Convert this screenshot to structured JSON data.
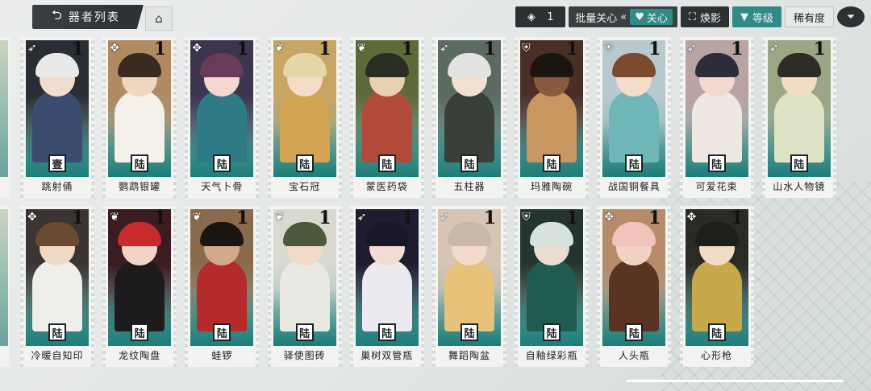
{
  "header": {
    "title": "器者列表"
  },
  "toolbar": {
    "count_value": "1",
    "batch_label": "批量关心",
    "batch_collapse": "«",
    "care_label": "关心",
    "skin_label": "焕影",
    "level_label": "等级",
    "rarity_label": "稀有度"
  },
  "colors": {
    "accent": "#2f8a88",
    "dark": "#2c3133"
  },
  "row1": [
    {
      "name": "跳射俑",
      "rank": "1",
      "seal": "壹",
      "icon": "bow-icon"
    },
    {
      "name": "鹦鹉银罐",
      "rank": "1",
      "seal": "陆",
      "icon": "knot-icon"
    },
    {
      "name": "天气卜骨",
      "rank": "1",
      "seal": "陆",
      "icon": "knot-icon"
    },
    {
      "name": "宝石冠",
      "rank": "1",
      "seal": "陆",
      "icon": "feather-icon"
    },
    {
      "name": "蒙医药袋",
      "rank": "1",
      "seal": "陆",
      "icon": "feather-icon"
    },
    {
      "name": "五柱器",
      "rank": "1",
      "seal": "陆",
      "icon": "bow-icon"
    },
    {
      "name": "玛雅陶碗",
      "rank": "1",
      "seal": "陆",
      "icon": "shield-icon"
    },
    {
      "name": "战国铜餐具",
      "rank": "1",
      "seal": "陆",
      "icon": "shield-icon"
    },
    {
      "name": "可爱花束",
      "rank": "1",
      "seal": "陆",
      "icon": "bow-icon"
    },
    {
      "name": "山水人物镜",
      "rank": "1",
      "seal": "陆",
      "icon": "bow-icon"
    }
  ],
  "row2": [
    {
      "name": "冷暖自知印",
      "rank": "1",
      "seal": "陆",
      "icon": "knot-icon"
    },
    {
      "name": "龙纹陶盘",
      "rank": "1",
      "seal": "陆",
      "icon": "feather-icon"
    },
    {
      "name": "蛙锣",
      "rank": "1",
      "seal": "陆",
      "icon": "feather-icon"
    },
    {
      "name": "驿使图砖",
      "rank": "1",
      "seal": "陆",
      "icon": "feather-icon"
    },
    {
      "name": "巢树双管瓶",
      "rank": "1",
      "seal": "陆",
      "icon": "bow-icon"
    },
    {
      "name": "舞蹈陶盆",
      "rank": "1",
      "seal": "陆",
      "icon": "bow-icon"
    },
    {
      "name": "自釉绿彩瓶",
      "rank": "1",
      "seal": "陆",
      "icon": "shield-icon"
    },
    {
      "name": "人头瓶",
      "rank": "1",
      "seal": "陆",
      "icon": "knot-icon"
    },
    {
      "name": "心形枪",
      "rank": "1",
      "seal": "陆",
      "icon": "knot-icon"
    }
  ]
}
